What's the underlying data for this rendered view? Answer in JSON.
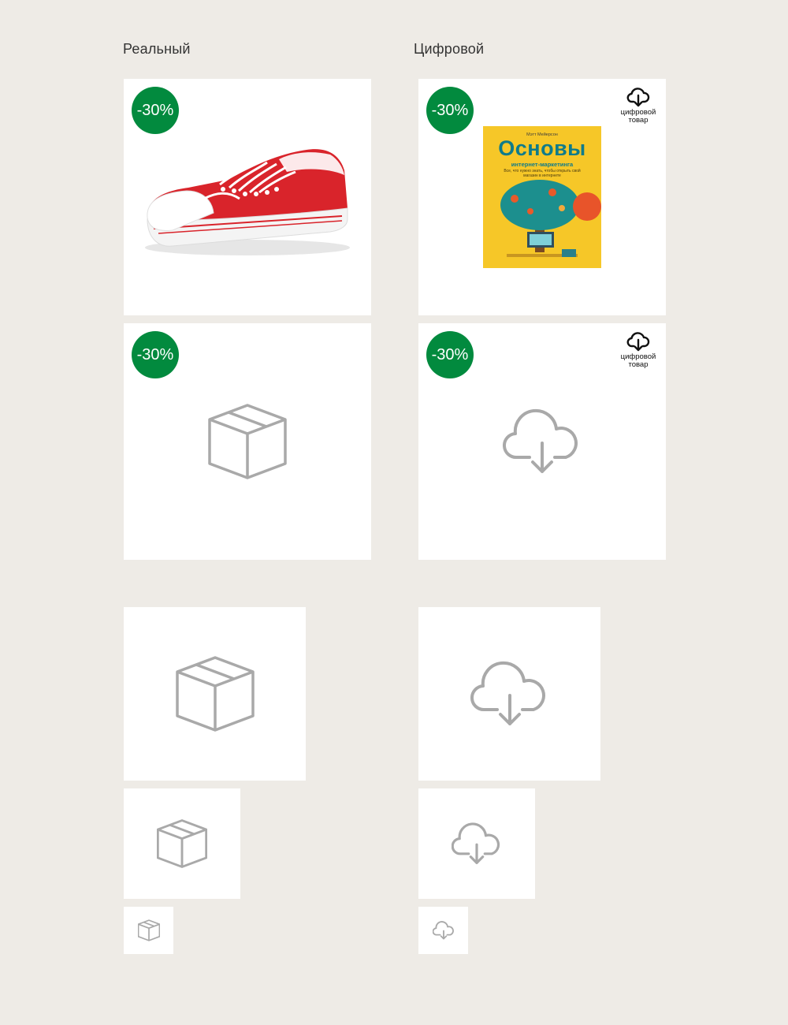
{
  "columns": {
    "real_title": "Реальный",
    "digital_title": "Цифровой"
  },
  "badges": {
    "discount": "-30%",
    "color": "#028a3e"
  },
  "digital_tag": {
    "line1": "цифровой",
    "line2": "товар",
    "icon": "cloud-download-icon"
  },
  "products": {
    "real_photo": {
      "image": "red-canvas-sneaker"
    },
    "digital_photo": {
      "image": "book-cover",
      "book": {
        "author": "Мэтт Мейерсон",
        "title": "Основы",
        "subtitle": "интернет-маркетинга",
        "note": "Все, что нужно знать, чтобы открыть свой магазин в интернете"
      }
    }
  },
  "placeholders": {
    "real_icon": "box-icon",
    "digital_icon": "cloud-download-icon"
  },
  "colors": {
    "background": "#eeebe6",
    "card": "#ffffff",
    "icon_gray": "#a9a9a9",
    "badge": "#028a3e"
  }
}
